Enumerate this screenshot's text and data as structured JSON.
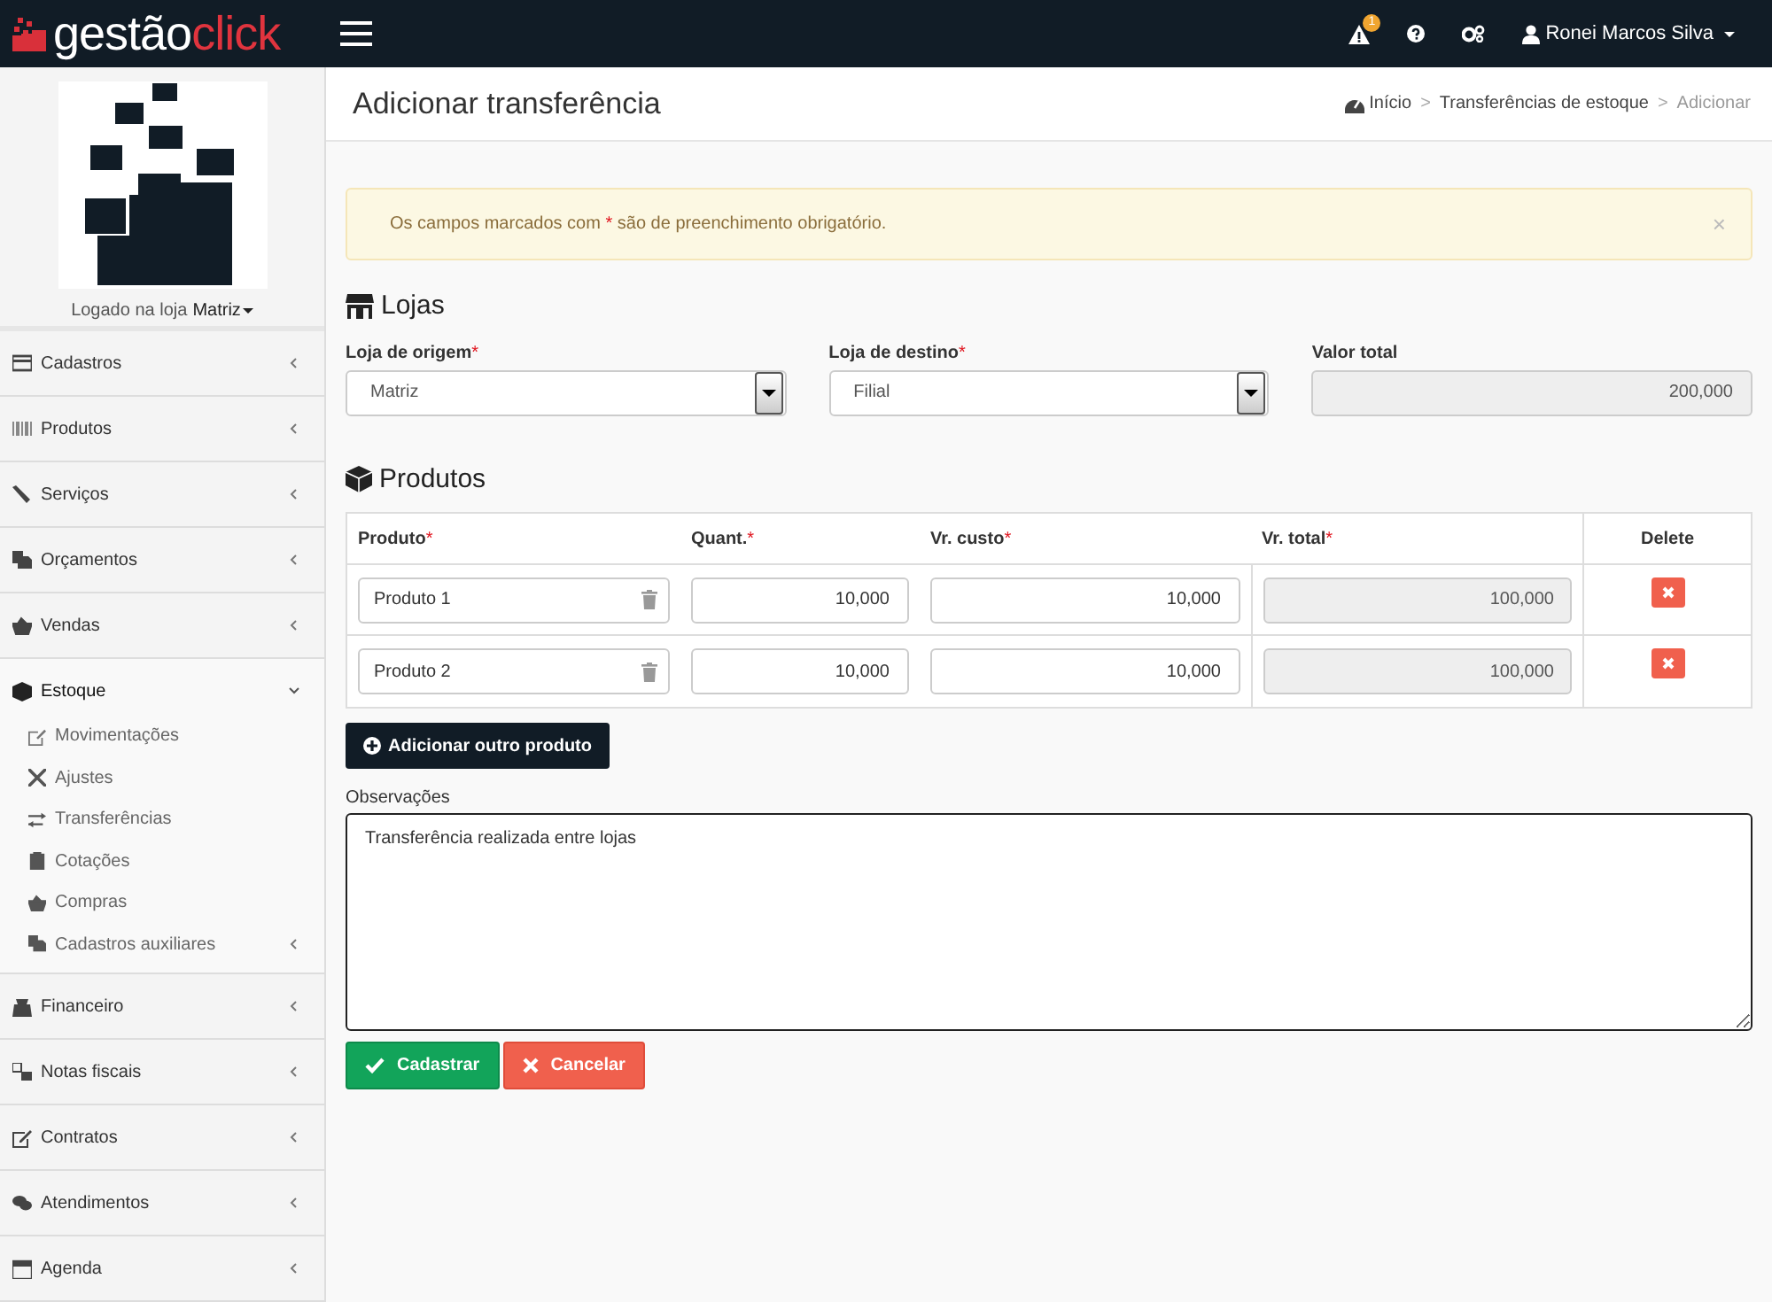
{
  "topbar": {
    "brand_first": "gestão",
    "brand_second": "click",
    "notification_count": "1",
    "user": "Ronei Marcos Silva"
  },
  "sidebar": {
    "store_label": "Logado na loja",
    "store": "Matriz",
    "items": [
      {
        "label": "Cadastros",
        "expanded": false
      },
      {
        "label": "Produtos",
        "expanded": false
      },
      {
        "label": "Serviços",
        "expanded": false
      },
      {
        "label": "Orçamentos",
        "expanded": false
      },
      {
        "label": "Vendas",
        "expanded": false
      },
      {
        "label": "Estoque",
        "expanded": true,
        "children": [
          {
            "label": "Movimentações",
            "has_submenu": false
          },
          {
            "label": "Ajustes",
            "has_submenu": false
          },
          {
            "label": "Transferências",
            "has_submenu": false
          },
          {
            "label": "Cotações",
            "has_submenu": false
          },
          {
            "label": "Compras",
            "has_submenu": false
          },
          {
            "label": "Cadastros auxiliares",
            "has_submenu": true
          }
        ]
      },
      {
        "label": "Financeiro",
        "expanded": false
      },
      {
        "label": "Notas fiscais",
        "expanded": false
      },
      {
        "label": "Contratos",
        "expanded": false
      },
      {
        "label": "Atendimentos",
        "expanded": false
      },
      {
        "label": "Agenda",
        "expanded": false
      }
    ]
  },
  "page_title": "Adicionar transferência",
  "breadcrumb": [
    {
      "label": "Início",
      "kind": "home"
    },
    {
      "label": "Transferências de estoque",
      "kind": "link"
    },
    {
      "label": "Adicionar",
      "kind": "current"
    }
  ],
  "breadcrumb_separator": ">",
  "alert": {
    "before": "Os campos marcados com",
    "mark": "*",
    "after": "são de preenchimento obrigatório.",
    "close": "×"
  },
  "lojas": {
    "title": "Lojas",
    "fields": [
      {
        "label": "Loja de origem",
        "required": true,
        "value": "Matriz",
        "kind": "select"
      },
      {
        "label": "Loja de destino",
        "required": true,
        "value": "Filial",
        "kind": "select"
      },
      {
        "label": "Valor total",
        "required": false,
        "value": "200,000",
        "kind": "readonly"
      }
    ]
  },
  "produtos": {
    "title": "Produtos",
    "columns": [
      {
        "label": "Produto",
        "required": true
      },
      {
        "label": "Quant.",
        "required": true
      },
      {
        "label": "Vr. custo",
        "required": true
      },
      {
        "label": "Vr. total",
        "required": true
      },
      {
        "label": "Delete",
        "required": false
      }
    ],
    "rows": [
      {
        "produto": "Produto 1",
        "quant": "10,000",
        "custo": "10,000",
        "total": "100,000"
      },
      {
        "produto": "Produto 2",
        "quant": "10,000",
        "custo": "10,000",
        "total": "100,000"
      }
    ],
    "add_button": "Adicionar outro produto"
  },
  "observacoes": {
    "label": "Observações",
    "value": "Transferência realizada entre lojas"
  },
  "actions": [
    {
      "label": "Cadastrar",
      "kind": "primary"
    },
    {
      "label": "Cancelar",
      "kind": "danger"
    }
  ]
}
